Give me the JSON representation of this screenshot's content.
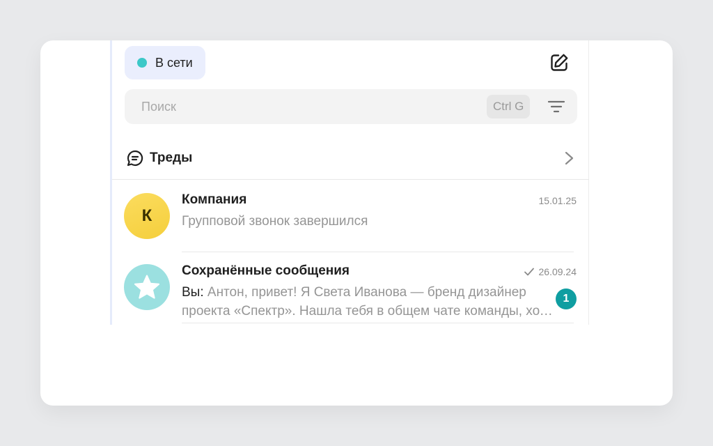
{
  "status": {
    "label": "В сети",
    "dot_color": "#3cc8c8"
  },
  "compose": {
    "icon": "compose-icon"
  },
  "search": {
    "placeholder": "Поиск",
    "value": "",
    "shortcut": "Ctrl G",
    "filter_icon": "filter-icon"
  },
  "threads": {
    "label": "Треды",
    "icon": "threads-icon"
  },
  "chats": [
    {
      "name": "Компания",
      "date": "15.01.25",
      "avatar_letter": "К",
      "avatar_color": "#f7d448",
      "preview": "Групповой звонок завершился"
    },
    {
      "name": "Сохранённые сообщения",
      "date": "26.09.24",
      "read_check": true,
      "avatar_icon": "star-icon",
      "avatar_color": "#9be0e0",
      "preview_sender": "Вы:",
      "preview": "Антон, привет! Я Света Иванова — бренд дизайнер проекта «Спектр». Нашла тебя в общем чате команды, хочу обсудить задачу.",
      "unread_count": "1"
    }
  ]
}
